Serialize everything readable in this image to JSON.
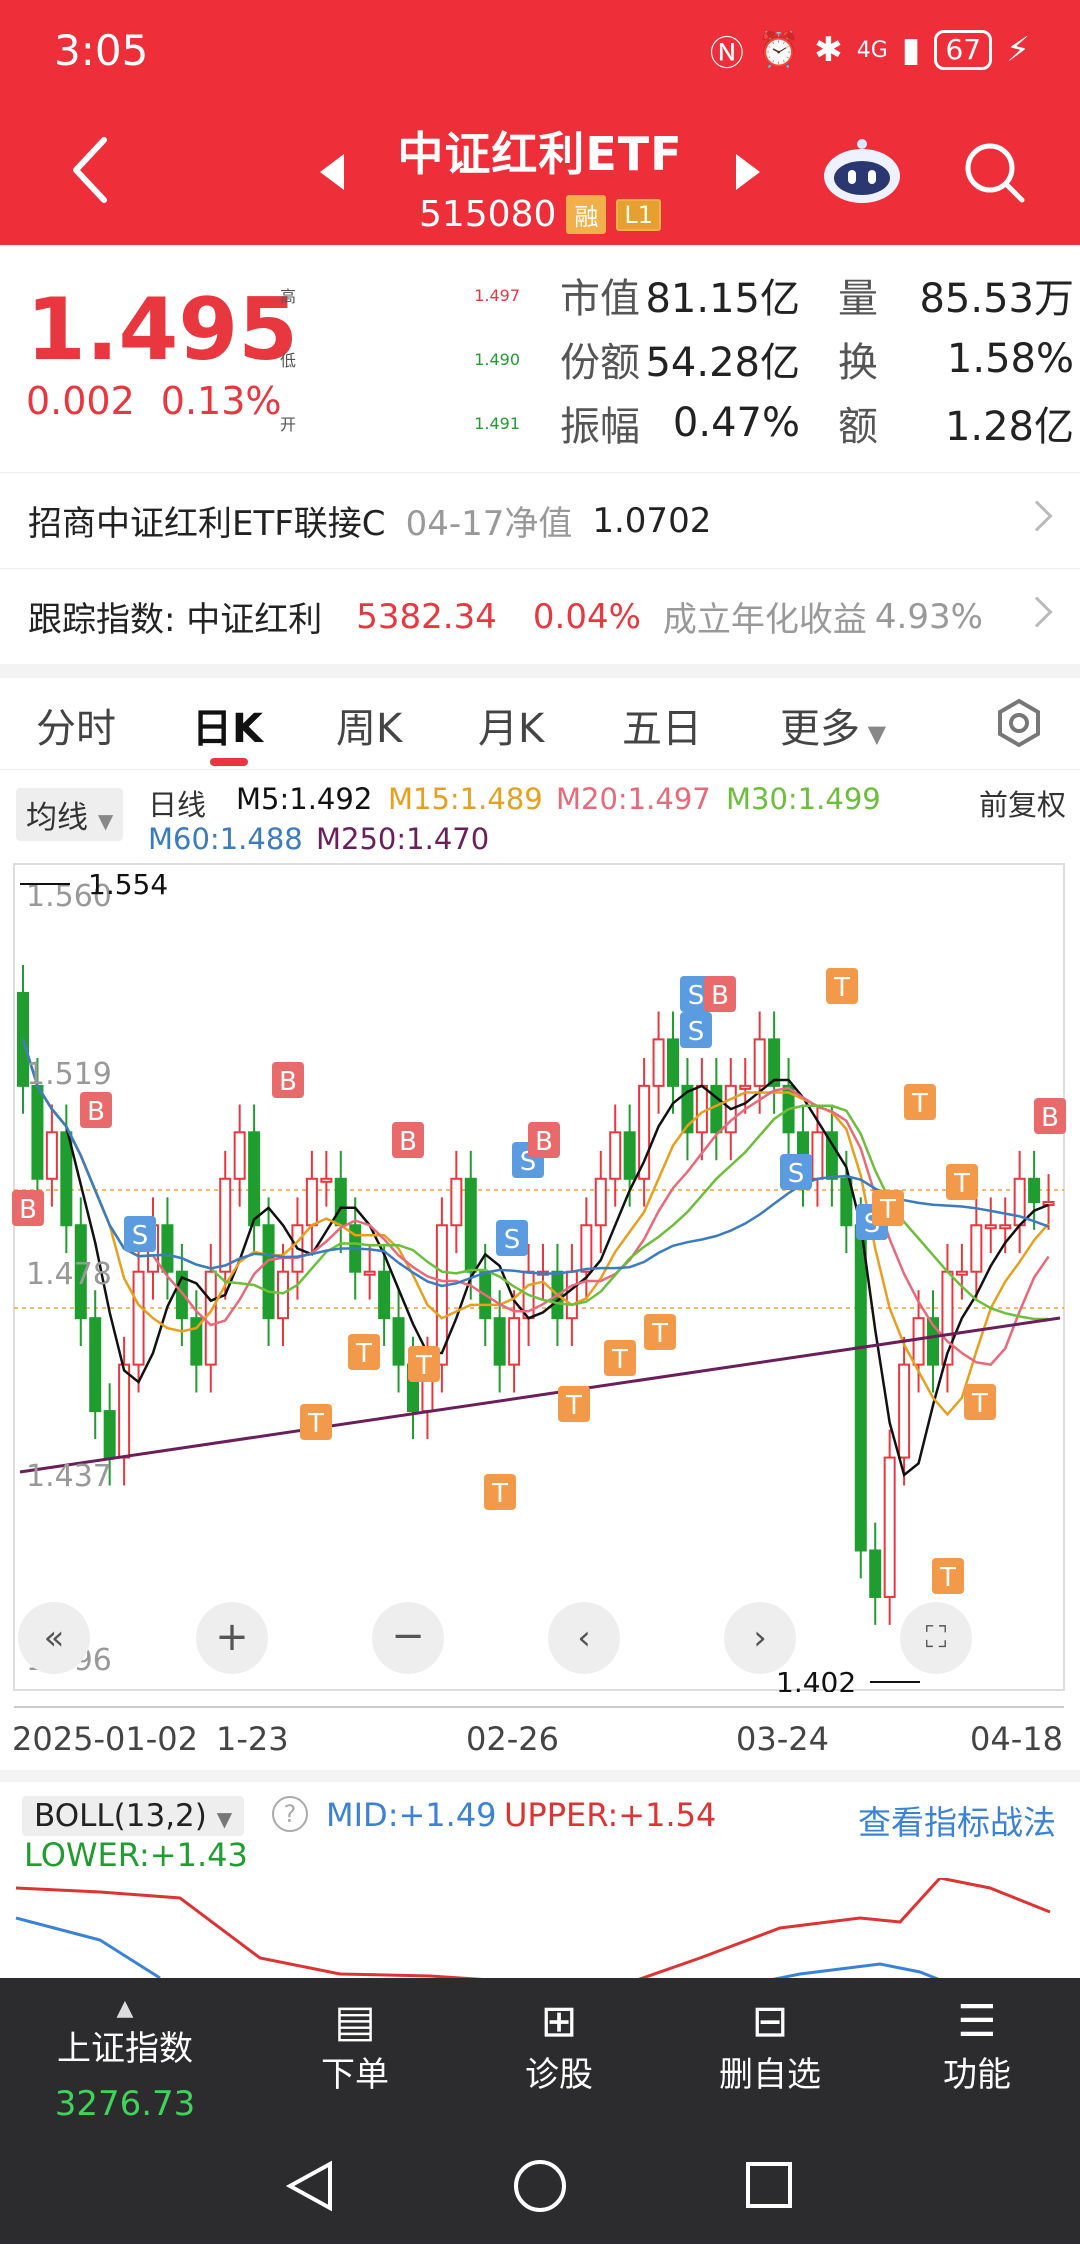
{
  "status": {
    "time": "3:05",
    "network": "4G",
    "battery": "67"
  },
  "header": {
    "title": "中证红利ETF",
    "code": "515080",
    "tag1": "融",
    "tag2": "L1"
  },
  "quote": {
    "price": "1.495",
    "change": "0.002",
    "change_pct": "0.13%",
    "high_label": "高",
    "high": "1.497",
    "low_label": "低",
    "low": "1.490",
    "open_label": "开",
    "open": "1.491",
    "mcap_label": "市值",
    "mcap": "81.15亿",
    "shares_label": "份额",
    "shares": "54.28亿",
    "amp_label": "振幅",
    "amp": "0.47%",
    "vol_label": "量",
    "vol": "85.53万",
    "turn_label": "换",
    "turn": "1.58%",
    "amt_label": "额",
    "amt": "1.28亿"
  },
  "link_fund": {
    "name": "招商中证红利ETF联接C",
    "date_label": "04-17净值",
    "nav": "1.0702"
  },
  "index_row": {
    "label": "跟踪指数: 中证红利",
    "value": "5382.34",
    "pct": "0.04%",
    "annual_label": "成立年化收益",
    "annual": "4.93%"
  },
  "tabs": [
    "分时",
    "日K",
    "周K",
    "月K",
    "五日",
    "更多"
  ],
  "ma": {
    "select": "均线",
    "type": "日线",
    "adj": "前复权",
    "m5": "M5:1.492",
    "m15": "M15:1.489",
    "m20": "M20:1.497",
    "m30": "M30:1.499",
    "m60": "M60:1.488",
    "m250": "M250:1.470"
  },
  "chart_labels": {
    "max_mark": "1.554",
    "min_mark": "1.402",
    "y1": "1.560",
    "y2": "1.519",
    "y3": "1.478",
    "y4": "1.437",
    "y5": "1.396"
  },
  "xaxis": [
    "2025-01-02",
    "1-23",
    "02-26",
    "03-24",
    "04-18"
  ],
  "boll": {
    "select": "BOLL(13,2)",
    "mid": "MID:+1.49",
    "upper": "UPPER:+1.54",
    "lower": "LOWER:+1.43",
    "link": "查看指标战法"
  },
  "bottom": {
    "index_name": "上证指数",
    "index_value": "3276.73",
    "order": "下单",
    "diagnose": "诊股",
    "delete": "删自选",
    "function": "功能"
  },
  "colors": {
    "brand": "#ee2f3a",
    "up": "#e8373f",
    "down": "#1f9d2e"
  }
}
